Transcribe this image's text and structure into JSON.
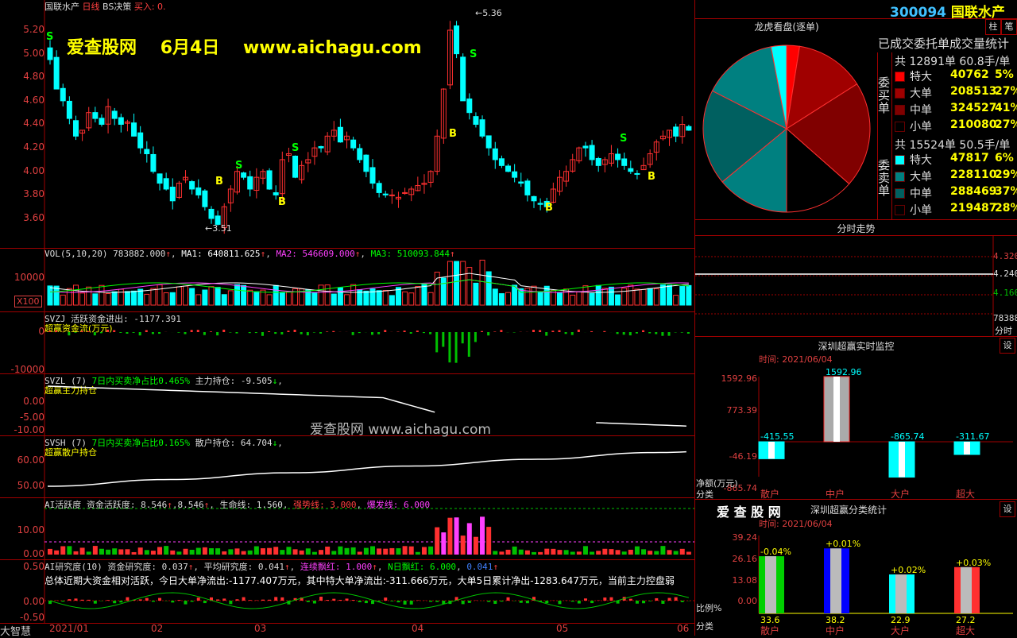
{
  "header": {
    "title": "国联水产",
    "period": "日线",
    "strategy": "BS决策",
    "buy_label": "买入",
    "buy_value": "0."
  },
  "watermark": {
    "site": "爱查股网",
    "date": "6月4日",
    "url": "www.aichagu.com",
    "url2": "爱查股网   www.aichagu.com"
  },
  "main_chart": {
    "price_ticks": [
      "5.20",
      "5.00",
      "4.80",
      "4.60",
      "4.40",
      "4.20",
      "4.00",
      "3.80",
      "3.60"
    ],
    "high_label": "5.36",
    "low_label": "3.51",
    "candles": [
      4.95,
      4.7,
      4.6,
      4.45,
      4.3,
      4.35,
      4.5,
      4.45,
      4.4,
      4.55,
      4.45,
      4.4,
      4.42,
      4.3,
      4.2,
      4.15,
      4.0,
      3.9,
      3.85,
      3.75,
      3.9,
      3.95,
      3.85,
      3.8,
      3.7,
      3.6,
      3.55,
      3.7,
      3.85,
      4.0,
      3.95,
      3.85,
      3.95,
      4.0,
      3.85,
      3.8,
      4.1,
      4.15,
      3.95,
      4.05,
      4.1,
      4.2,
      4.2,
      4.3,
      4.35,
      4.25,
      4.3,
      4.2,
      4.1,
      4.0,
      3.9,
      3.82,
      3.8,
      3.8,
      3.78,
      3.82,
      3.85,
      3.88,
      3.9,
      4.0,
      4.3,
      4.7,
      5.2,
      5.0,
      4.6,
      4.5,
      4.4,
      4.3,
      4.2,
      4.1,
      4.05,
      4.0,
      3.95,
      3.9,
      3.8,
      3.75,
      3.72,
      3.7,
      3.85,
      3.95,
      4.0,
      4.1,
      4.2,
      4.2,
      4.1,
      4.05,
      4.1,
      4.15,
      4.1,
      4.05,
      4.0,
      3.98,
      4.05,
      4.15,
      4.25,
      4.3,
      4.35,
      4.3,
      4.4,
      4.35
    ]
  },
  "vol": {
    "label": "VOL(5,10,20)",
    "value": "783882.000",
    "ma1": "MA1: 640811.625",
    "ma2": "MA2: 546609.000",
    "ma3": "MA3: 510093.844",
    "tick": "10000",
    "unit": "X100"
  },
  "svzj": {
    "label": "SVZJ  活跃资金进出: -1177.391",
    "sub": "超赢资金流(万元)",
    "ticks": [
      "0",
      "-10000"
    ]
  },
  "svzl": {
    "label": "SVZL (7)",
    "ratio": "7日内买卖净占比0.465%",
    "hold": "主力持仓: -9.505",
    "sub": "超赢主力持仓",
    "ticks": [
      "0.00",
      "-5.00",
      "-10.00"
    ]
  },
  "svsh": {
    "label": "SVSH (7)",
    "ratio": "7日内买卖净占比0.165%",
    "hold": "散户持仓: 64.704",
    "sub": "超赢散户持仓",
    "ticks": [
      "60.00",
      "50.00"
    ]
  },
  "ai_active": {
    "label": "AI活跃度",
    "active": "资金活跃度: 8.546",
    "v2": "8.546",
    "life": "生命线: 1.560",
    "strong": "强势线: 3.000",
    "burst": "爆发线: 6.000",
    "ticks": [
      "10.00",
      "0.00"
    ]
  },
  "ai_research": {
    "label": "AI研究度(10)",
    "research": "资金研究度: 0.037",
    "avg": "平均研究度: 0.041",
    "cont": "连续飘红: 1.000",
    "nday": "N日飘红: 6.000",
    "v5": "0.041",
    "summary": "总体近期大资金相对活跃，今日大单净流出:-1177.407万元，其中特大单净流出:-311.666万元，大单5日累计净出-1283.647万元，当前主力控盘弱",
    "ticks": [
      "0.50",
      "0.00",
      "-0.50"
    ]
  },
  "footer": {
    "app": "大智慧",
    "dates": [
      "2021/01",
      "02",
      "03",
      "04",
      "05",
      "06"
    ]
  },
  "right": {
    "code": "300094",
    "name": "国联水产",
    "pie_title": "龙虎看盘(逐单)",
    "stat_title": "已成交委托单成交量统计",
    "buy_side": {
      "label": "委买单",
      "total": "共 12891单 60.8手/单",
      "rows": [
        {
          "name": "特大",
          "value": "40762",
          "pct": "5%",
          "color": "#ff0000"
        },
        {
          "name": "大单",
          "value": "208513",
          "pct": "27%",
          "color": "#a00000"
        },
        {
          "name": "中单",
          "value": "324527",
          "pct": "41%",
          "color": "#800000"
        },
        {
          "name": "小单",
          "value": "210080",
          "pct": "27%",
          "color": "#000000"
        }
      ]
    },
    "sell_side": {
      "label": "委卖单",
      "total": "共 15524单 50.5手/单",
      "rows": [
        {
          "name": "特大",
          "value": "47817",
          "pct": "6%",
          "color": "#00ffff"
        },
        {
          "name": "大单",
          "value": "228110",
          "pct": "29%",
          "color": "#008080"
        },
        {
          "name": "中单",
          "value": "288469",
          "pct": "37%",
          "color": "#006060"
        },
        {
          "name": "小单",
          "value": "219487",
          "pct": "28%",
          "color": "#000000"
        }
      ]
    },
    "btn1": "柱",
    "btn2": "笔",
    "intraday_title": "分时走势",
    "intraday_ticks": [
      "4.320",
      "4.240",
      "4.160"
    ],
    "intraday_vol": "78388",
    "intraday_vol_unit": "分时",
    "monitor_title": "深圳超赢实时监控",
    "monitor_time": "时间: 2021/06/04",
    "set_label": "设",
    "monitor_ticks": [
      "1592.96",
      "773.39",
      "-46.19",
      "-865.74"
    ],
    "monitor_unit": "净额(万元)",
    "monitor_cat": "分类",
    "monitor_bars": [
      {
        "cat": "散户",
        "value": "-415.55"
      },
      {
        "cat": "中户",
        "value": "1592.96"
      },
      {
        "cat": "大户",
        "value": "-865.74"
      },
      {
        "cat": "超大",
        "value": "-311.67"
      }
    ],
    "stat2_brand": "爱 查 股 网",
    "stat2_title": "深圳超赢分类统计",
    "stat2_time": "时间: 2021/06/04",
    "stat2_ticks": [
      "39.24",
      "26.16",
      "13.08",
      "0.00"
    ],
    "stat2_unit": "比例%",
    "stat2_cat": "分类",
    "stat2_bars": [
      {
        "cat": "散户",
        "value": "33.6",
        "chg": "-0.04%"
      },
      {
        "cat": "中户",
        "value": "38.2",
        "chg": "+0.01%"
      },
      {
        "cat": "大户",
        "value": "22.9",
        "chg": "+0.02%"
      },
      {
        "cat": "超大",
        "value": "27.2",
        "chg": "+0.03%"
      }
    ]
  }
}
